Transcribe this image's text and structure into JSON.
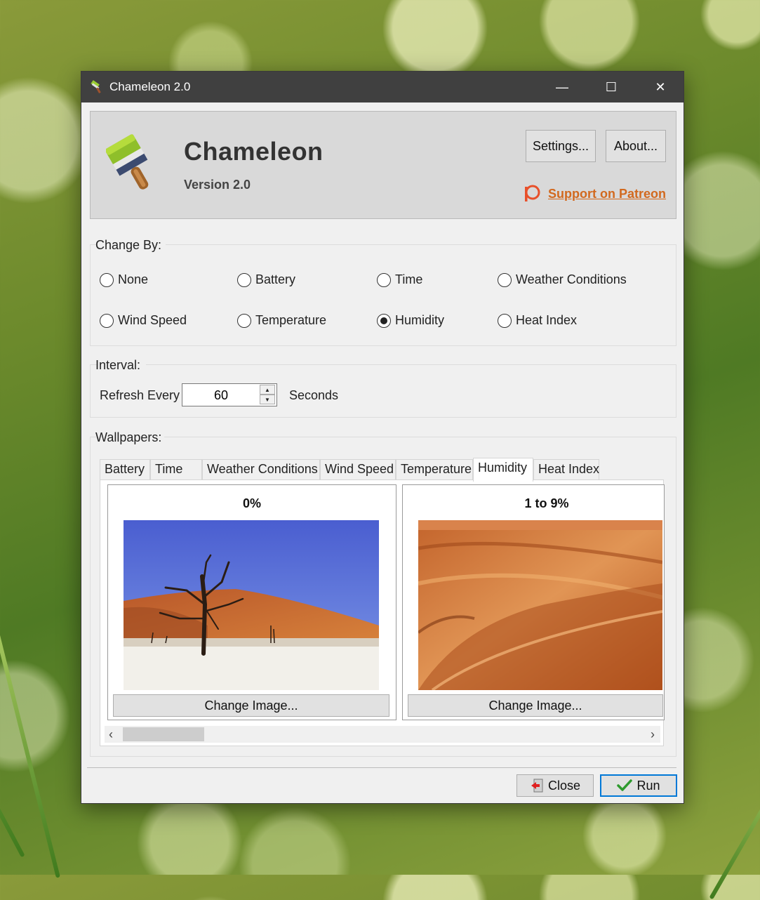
{
  "window": {
    "title": "Chameleon 2.0",
    "minimize_glyph": "—",
    "maximize_glyph": "☐",
    "close_glyph": "✕"
  },
  "header": {
    "app_name": "Chameleon",
    "version": "Version 2.0",
    "settings_label": "Settings...",
    "about_label": "About...",
    "patreon_label": "Support on Patreon"
  },
  "change_by": {
    "title": "Change By:",
    "options": [
      {
        "label": "None",
        "checked": false
      },
      {
        "label": "Battery",
        "checked": false
      },
      {
        "label": "Time",
        "checked": false
      },
      {
        "label": "Weather Conditions",
        "checked": false
      },
      {
        "label": "Wind Speed",
        "checked": false
      },
      {
        "label": "Temperature",
        "checked": false
      },
      {
        "label": "Humidity",
        "checked": true
      },
      {
        "label": "Heat Index",
        "checked": false
      }
    ]
  },
  "interval": {
    "title": "Interval:",
    "prefix": "Refresh Every",
    "value": "60",
    "suffix": "Seconds"
  },
  "wallpapers": {
    "title": "Wallpapers:",
    "tabs": [
      "Battery",
      "Time",
      "Weather Conditions",
      "Wind Speed",
      "Temperature",
      "Humidity",
      "Heat Index"
    ],
    "active_tab": "Humidity",
    "cards": [
      {
        "label": "0%",
        "button": "Change Image..."
      },
      {
        "label": "1 to 9%",
        "button": "Change Image..."
      }
    ]
  },
  "footer": {
    "close_label": "Close",
    "run_label": "Run"
  },
  "colors": {
    "titlebar": "#404040",
    "patreon": "#d2691e",
    "run_border": "#0078d7"
  }
}
